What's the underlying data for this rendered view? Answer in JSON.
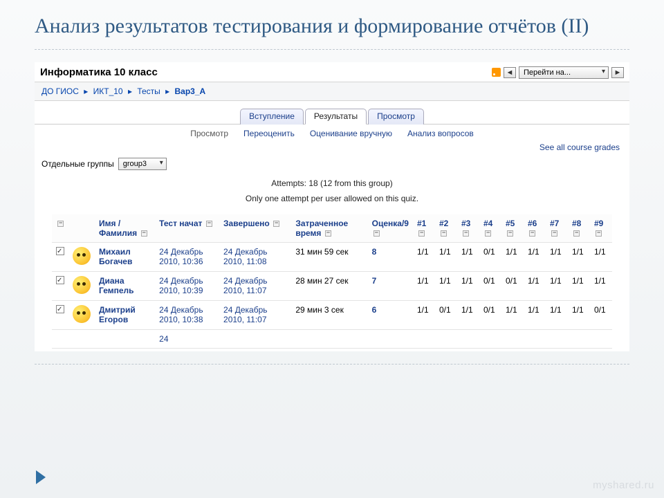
{
  "slide": {
    "title": "Анализ результатов тестирования и формирование отчётов  (II)"
  },
  "header": {
    "course_title": "Информатика 10 класс",
    "jump_label": "Перейти на..."
  },
  "breadcrumbs": {
    "items": [
      "ДО ГИОС",
      "ИКТ_10",
      "Тесты"
    ],
    "current": "Вар3_А",
    "sep": "▸"
  },
  "tabs": {
    "items": [
      "Вступление",
      "Результаты",
      "Просмотр"
    ],
    "active_index": 1
  },
  "subnav": {
    "items": [
      "Просмотр",
      "Переоценить",
      "Оценивание вручную",
      "Анализ вопросов"
    ],
    "current_index": 0
  },
  "links": {
    "see_all_grades": "See all course grades"
  },
  "filters": {
    "groups_label": "Отдельные группы",
    "group_selected": "group3"
  },
  "info": {
    "attempts_line": "Attempts: 18 (12 from this group)",
    "rule_line": "Only one attempt per user allowed on this quiz."
  },
  "table": {
    "headers": {
      "name": "Имя / Фамилия",
      "started": "Тест начат",
      "completed": "Завершено",
      "time_taken": "Затраченное время",
      "grade": "Оценка/9"
    },
    "q_labels": [
      "#1",
      "#2",
      "#3",
      "#4",
      "#5",
      "#6",
      "#7",
      "#8",
      "#9"
    ],
    "rows": [
      {
        "name": "Михаил Богачев",
        "started": "24 Декабрь 2010, 10:36",
        "completed": "24 Декабрь 2010, 11:08",
        "time_taken": "31 мин 59 сек",
        "grade": "8",
        "q": [
          "1/1",
          "1/1",
          "1/1",
          "0/1",
          "1/1",
          "1/1",
          "1/1",
          "1/1",
          "1/1"
        ]
      },
      {
        "name": "Диана Гемпель",
        "started": "24 Декабрь 2010, 10:39",
        "completed": "24 Декабрь 2010, 11:07",
        "time_taken": "28 мин 27 сек",
        "grade": "7",
        "q": [
          "1/1",
          "1/1",
          "1/1",
          "0/1",
          "0/1",
          "1/1",
          "1/1",
          "1/1",
          "1/1"
        ]
      },
      {
        "name": "Дмитрий Егоров",
        "started": "24 Декабрь 2010, 10:38",
        "completed": "24 Декабрь 2010, 11:07",
        "time_taken": "29 мин 3 сек",
        "grade": "6",
        "q": [
          "1/1",
          "0/1",
          "1/1",
          "0/1",
          "1/1",
          "1/1",
          "1/1",
          "1/1",
          "0/1"
        ]
      }
    ],
    "partial_row_started": "24"
  },
  "watermark": "myshared.ru"
}
